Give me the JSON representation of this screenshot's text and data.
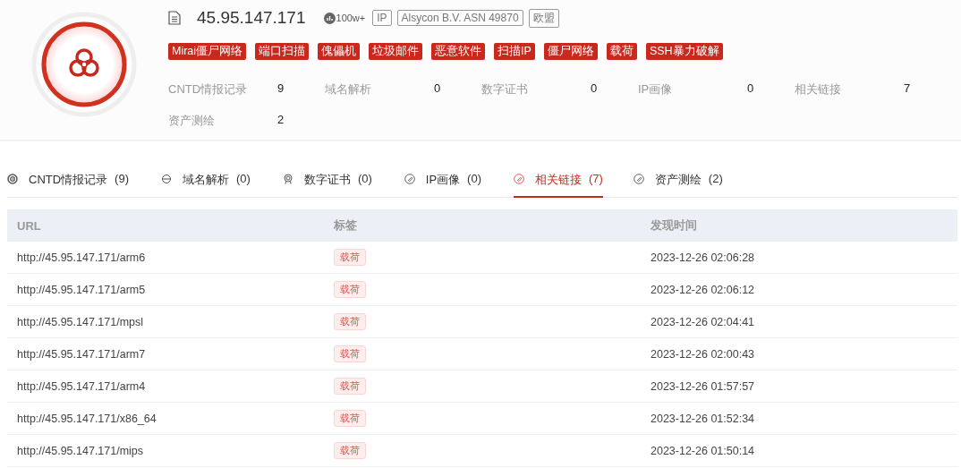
{
  "header": {
    "ip": "45.95.147.171",
    "popularity": "100w+",
    "badges": [
      "IP",
      "Alsycon B.V. ASN 49870",
      "欧盟"
    ],
    "tags": [
      "Mirai僵尸网络",
      "端口扫描",
      "傀儡机",
      "垃圾邮件",
      "恶意软件",
      "扫描IP",
      "僵尸网络",
      "载荷",
      "SSH暴力破解"
    ],
    "stats": [
      {
        "label": "CNTD情报记录",
        "value": "9"
      },
      {
        "label": "域名解析",
        "value": "0"
      },
      {
        "label": "数字证书",
        "value": "0"
      },
      {
        "label": "IP画像",
        "value": "0"
      },
      {
        "label": "相关链接",
        "value": "7"
      },
      {
        "label": "资产测绘",
        "value": "2"
      }
    ]
  },
  "tabs": [
    {
      "label": "CNTD情报记录",
      "count": "(9)",
      "selected": false
    },
    {
      "label": "域名解析",
      "count": "(0)",
      "selected": false
    },
    {
      "label": "数字证书",
      "count": "(0)",
      "selected": false
    },
    {
      "label": "IP画像",
      "count": "(0)",
      "selected": false
    },
    {
      "label": "相关链接",
      "count": "(7)",
      "selected": true
    },
    {
      "label": "资产测绘",
      "count": "(2)",
      "selected": false
    }
  ],
  "table": {
    "columns": [
      "URL",
      "标签",
      "发现时间"
    ],
    "rows": [
      {
        "url": "http://45.95.147.171/arm6",
        "tag": "载荷",
        "time": "2023-12-26 02:06:28"
      },
      {
        "url": "http://45.95.147.171/arm5",
        "tag": "载荷",
        "time": "2023-12-26 02:06:12"
      },
      {
        "url": "http://45.95.147.171/mpsl",
        "tag": "载荷",
        "time": "2023-12-26 02:04:41"
      },
      {
        "url": "http://45.95.147.171/arm7",
        "tag": "载荷",
        "time": "2023-12-26 02:00:43"
      },
      {
        "url": "http://45.95.147.171/arm4",
        "tag": "载荷",
        "time": "2023-12-26 01:57:57"
      },
      {
        "url": "http://45.95.147.171/x86_64",
        "tag": "载荷",
        "time": "2023-12-26 01:52:34"
      },
      {
        "url": "http://45.95.147.171/mips",
        "tag": "载荷",
        "time": "2023-12-26 01:50:14"
      }
    ]
  }
}
